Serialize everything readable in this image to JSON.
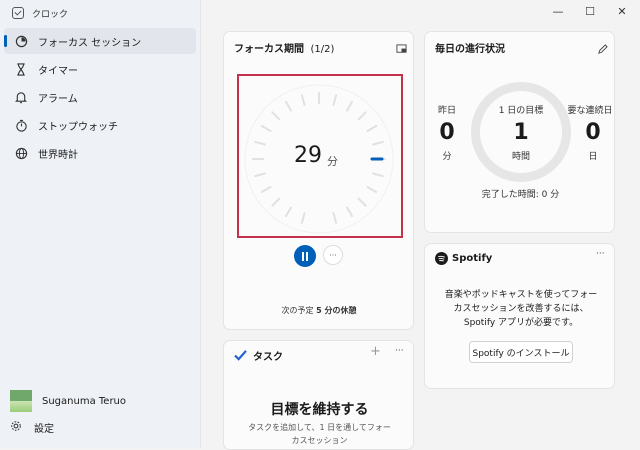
{
  "app": {
    "title": "クロック"
  },
  "sidebar": {
    "items": [
      {
        "label": "フォーカス セッション",
        "icon": "focus-icon",
        "active": true
      },
      {
        "label": "タイマー",
        "icon": "hourglass-icon",
        "active": false
      },
      {
        "label": "アラーム",
        "icon": "bell-icon",
        "active": false
      },
      {
        "label": "ストップウォッチ",
        "icon": "stopwatch-icon",
        "active": false
      },
      {
        "label": "世界時計",
        "icon": "globe-icon",
        "active": false
      }
    ],
    "user_name": "Suganuma Teruo",
    "settings_label": "設定"
  },
  "window_controls": {
    "minimize": "—",
    "maximize": "☐",
    "close": "✕"
  },
  "focus": {
    "title": "フォーカス期間",
    "period": "(1/2)",
    "minutes": "29",
    "minutes_unit": "分",
    "more": "···",
    "next_prefix": "次の予定",
    "next_value": "5 分の休憩"
  },
  "daily": {
    "title": "毎日の進行状況",
    "yesterday_label": "昨日",
    "yesterday_value": "0",
    "yesterday_unit": "分",
    "goal_label": "1 日の目標",
    "goal_value": "1",
    "goal_unit": "時間",
    "streak_label": "要な連続日",
    "streak_value": "0",
    "streak_unit": "日",
    "completed": "完了した時間: 0 分"
  },
  "spotify": {
    "brand": "Spotify",
    "more": "···",
    "message": "音楽やポッドキャストを使ってフォーカスセッションを改善するには、Spotify アプリが必要です。",
    "install_label": "Spotify のインストール"
  },
  "tasks": {
    "title": "タスク",
    "add": "+",
    "more": "···",
    "heading": "目標を維持する",
    "body": "タスクを追加して、1 日を通してフォーカスセッション"
  },
  "colors": {
    "accent": "#005fb8",
    "highlight": "#c4314b"
  }
}
